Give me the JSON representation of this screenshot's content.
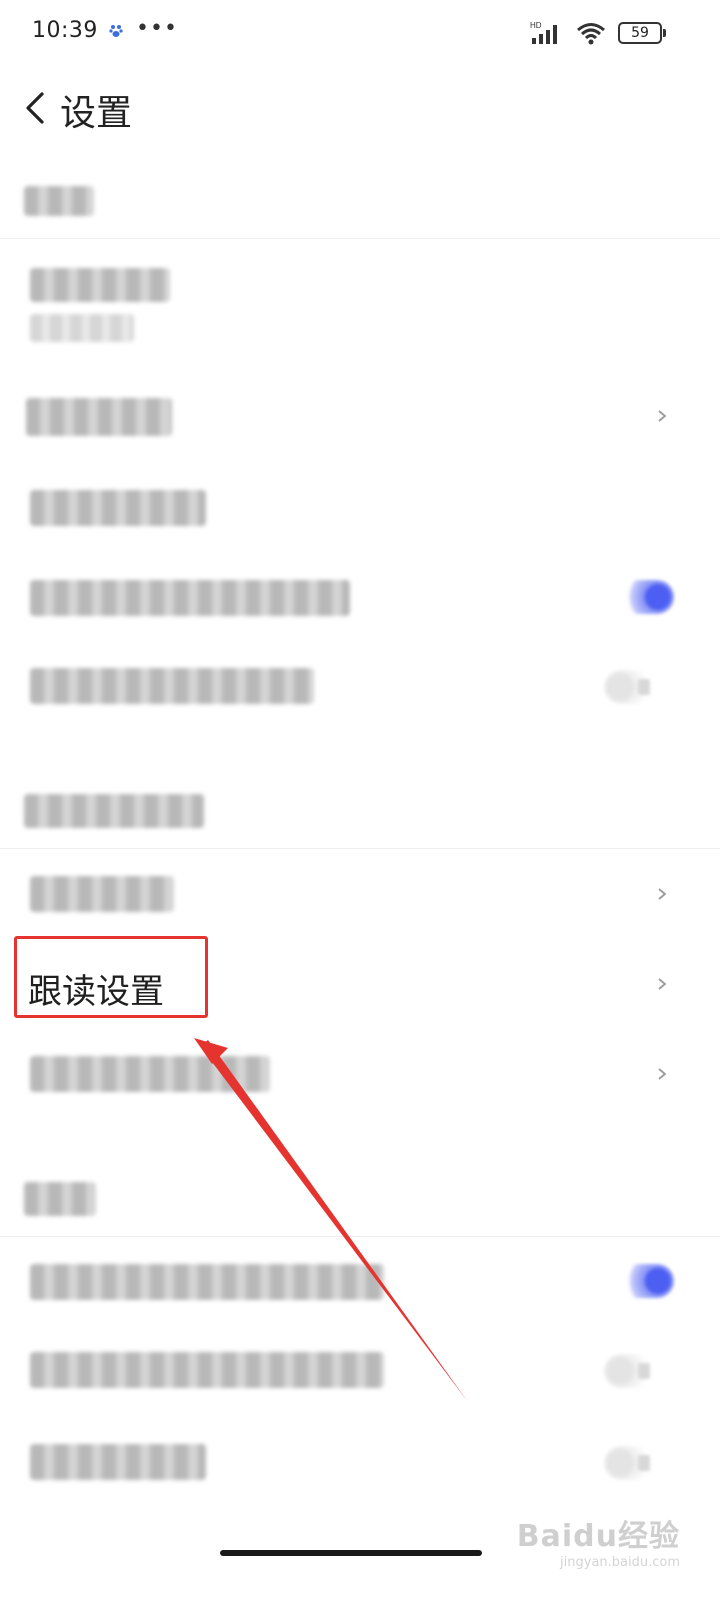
{
  "status_bar": {
    "time": "10:39",
    "dots": "•••",
    "network_label": "HD",
    "battery": "59"
  },
  "header": {
    "title": "设置"
  },
  "highlighted_item": {
    "label": "跟读设置"
  },
  "watermark": {
    "logo": "Baidu经验",
    "sub": "jingyan.baidu.com"
  },
  "colors": {
    "accent_toggle": "#4c5ff2",
    "highlight_red": "#e53430"
  },
  "icons": {
    "back": "chevron-left-icon",
    "chevron": "chevron-right-icon",
    "wifi": "wifi-icon",
    "signal": "signal-icon",
    "battery": "battery-icon"
  }
}
